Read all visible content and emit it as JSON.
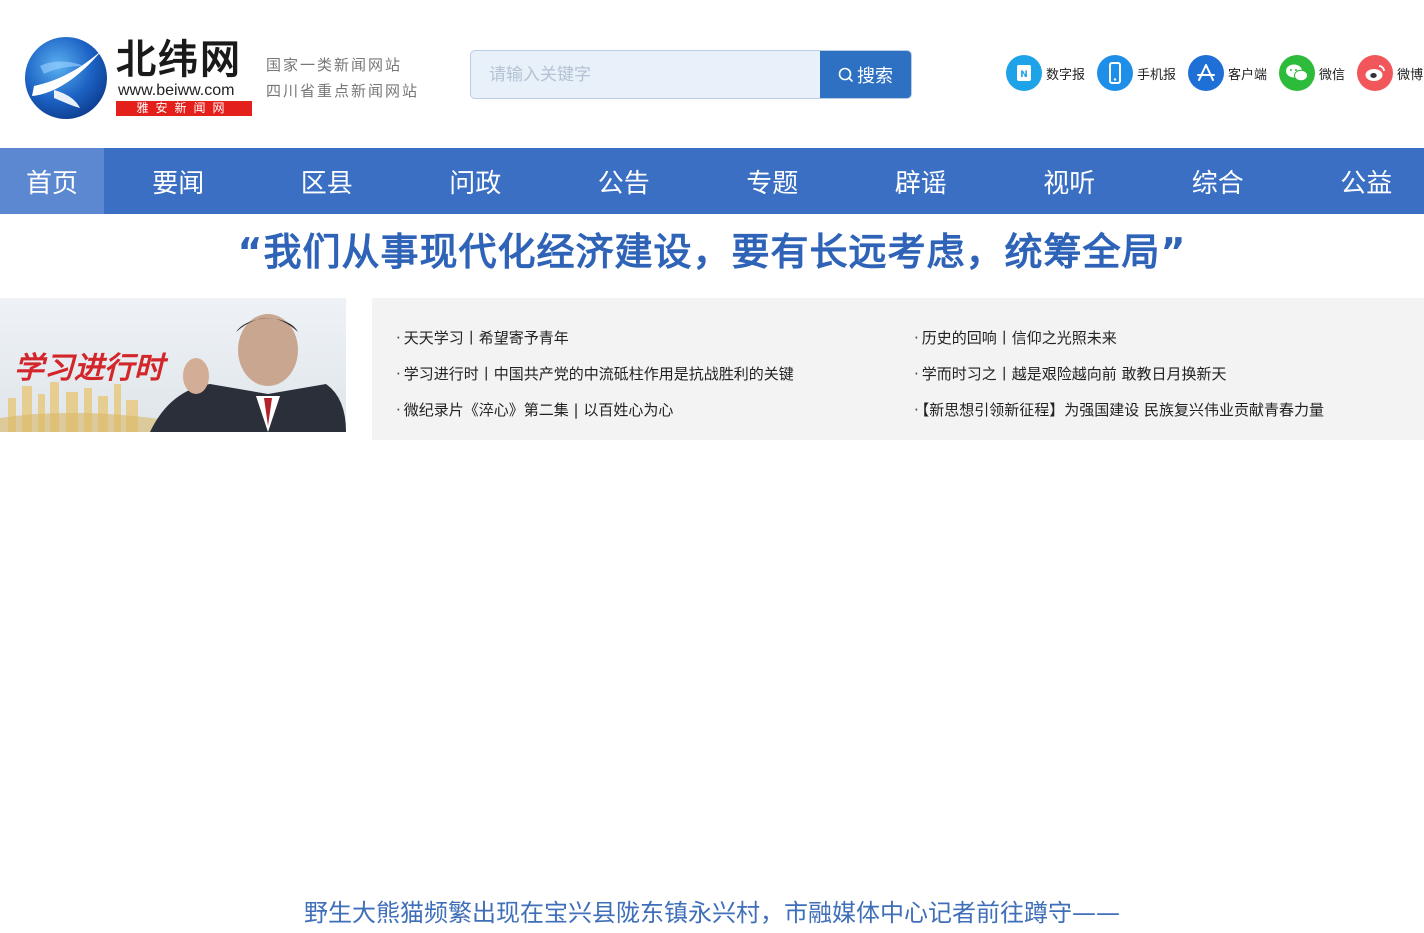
{
  "logo": {
    "name": "北纬网",
    "url": "www.beiww.com",
    "sub": "雅安新闻网"
  },
  "slogans": [
    "国家一类新闻网站",
    "四川省重点新闻网站"
  ],
  "search": {
    "placeholder": "请输入关键字",
    "button": "搜索"
  },
  "apps": [
    {
      "label": "数字报",
      "icon": "digital-paper-icon",
      "color": "#1fa3e8"
    },
    {
      "label": "手机报",
      "icon": "mobile-phone-icon",
      "color": "#1e8fe8"
    },
    {
      "label": "客户端",
      "icon": "app-store-icon",
      "color": "#1e6fd6"
    },
    {
      "label": "微信",
      "icon": "wechat-icon",
      "color": "#2dbb3c"
    },
    {
      "label": "微博",
      "icon": "weibo-icon",
      "color": "#f0565a"
    }
  ],
  "nav": [
    "首页",
    "要闻",
    "区县",
    "问政",
    "公告",
    "专题",
    "辟谣",
    "视听",
    "综合",
    "公益"
  ],
  "headline": "“我们从事现代化经济建设，要有长远考虑，统筹全局”",
  "study": {
    "banner_text": "学习进行时",
    "left": [
      "天天学习丨希望寄予青年",
      "学习进行时丨中国共产党的中流砥柱作用是抗战胜利的关键",
      "微纪录片《淬心》第二集 | 以百姓心为心"
    ],
    "right": [
      "历史的回响丨信仰之光照未来",
      "学而时习之丨越是艰险越向前 敢教日月换新天",
      "【新思想引领新征程】为强国建设 民族复兴伟业贡献青春力量"
    ]
  },
  "feature": "野生大熊猫频繁出现在宝兴县陇东镇永兴村，市融媒体中心记者前往蹲守——",
  "colors": {
    "nav_bg": "#3a6fc3",
    "nav_active": "#5b88d1",
    "headline": "#2e63b8",
    "search_button": "#2e70c2",
    "logo_red": "#e3201b"
  }
}
